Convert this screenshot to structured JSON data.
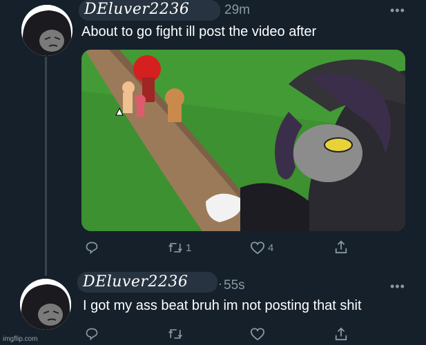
{
  "tweet1": {
    "handle": "DEluver2236",
    "time": "29m",
    "text": "About to go fight ill post the video after",
    "actions": {
      "reply": "",
      "retweet": "1",
      "like": "4",
      "share": ""
    },
    "more": "•••"
  },
  "tweet2": {
    "handle": "DEluver2236",
    "time": "55s",
    "text": "I got my ass beat bruh im not posting that shit",
    "more": "•••"
  },
  "colors": {
    "background": "#15202b",
    "muted": "#8899a6",
    "thread_line": "#38444d"
  },
  "icons": [
    "reply-icon",
    "retweet-icon",
    "like-icon",
    "share-icon",
    "more-icon"
  ],
  "watermark": "imgflip.com"
}
